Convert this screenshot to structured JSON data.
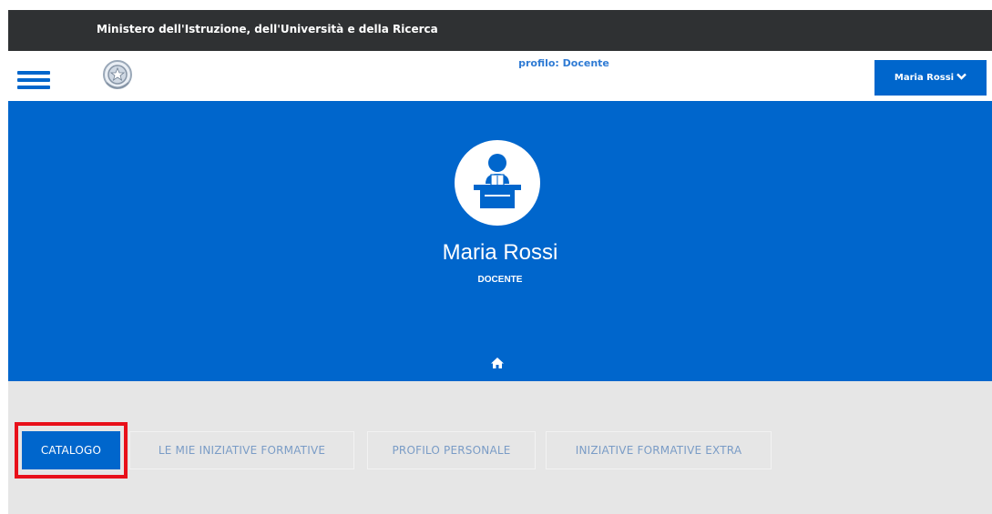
{
  "topbar": {
    "ministry": "Ministero dell'Istruzione, dell'Università e della Ricerca"
  },
  "header": {
    "profile_label": "profilo: Docente",
    "user_button": "Maria Rossi",
    "icons": [
      "hamburger-menu-icon",
      "republic-emblem-logo",
      "chevron-down-icon"
    ]
  },
  "hero": {
    "name": "Maria Rossi",
    "role": "DOCENTE",
    "icons": [
      "teacher-avatar-icon",
      "home-icon"
    ]
  },
  "tabs": [
    {
      "label": "CATALOGO",
      "active": true,
      "highlighted": true
    },
    {
      "label": "LE MIE INIZIATIVE FORMATIVE",
      "active": false
    },
    {
      "label": "PROFILO PERSONALE",
      "active": false
    },
    {
      "label": "INIZIATIVE FORMATIVE EXTRA",
      "active": false
    }
  ],
  "colors": {
    "primary": "#0066cc",
    "topbar": "#2f3133",
    "tabs_background": "#e6e6e6",
    "highlight": "#e8101a",
    "inactive_tab_text": "#7a9cc6"
  }
}
